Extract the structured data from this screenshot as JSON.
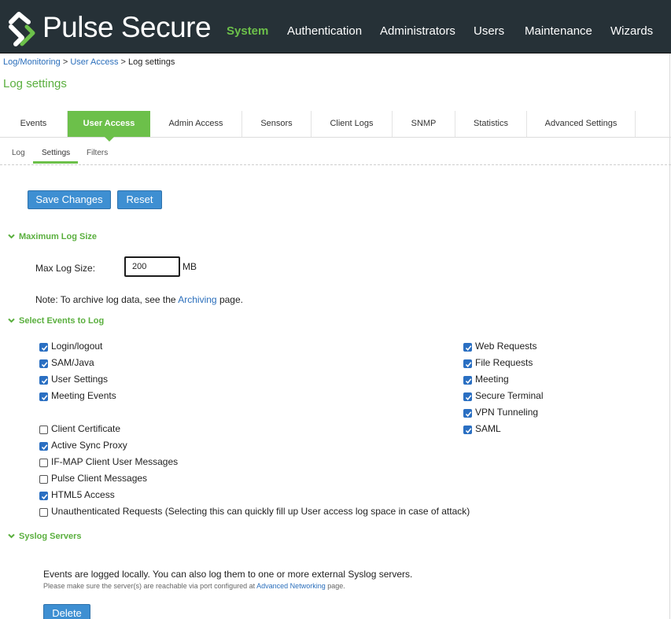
{
  "brand": {
    "name": "Pulse Secure",
    "accent": "#6cc04a",
    "link_color": "#2a6ebb",
    "header_bg": "#263137",
    "button_color": "#3e8fd2"
  },
  "nav": {
    "items": [
      {
        "label": "System",
        "active": true
      },
      {
        "label": "Authentication"
      },
      {
        "label": "Administrators"
      },
      {
        "label": "Users"
      },
      {
        "label": "Maintenance"
      },
      {
        "label": "Wizards"
      }
    ]
  },
  "breadcrumb": {
    "items": [
      "Log/Monitoring",
      "User Access"
    ],
    "current": "Log settings",
    "separator": ">"
  },
  "page_title": "Log settings",
  "tabs": [
    "Events",
    "User Access",
    "Admin Access",
    "Sensors",
    "Client Logs",
    "SNMP",
    "Statistics",
    "Advanced Settings"
  ],
  "active_tab": "User Access",
  "subtabs": [
    "Log",
    "Settings",
    "Filters"
  ],
  "active_subtab": "Settings",
  "buttons": {
    "save": "Save Changes",
    "reset": "Reset",
    "delete": "Delete"
  },
  "max_log_size": {
    "section_title": "Maximum Log Size",
    "label": "Max Log Size:",
    "value": "200",
    "unit": "MB",
    "note_prefix": "Note: To archive log data, see the",
    "note_link": "Archiving",
    "note_suffix": "page."
  },
  "select_events": {
    "section_title": "Select Events to Log",
    "left": [
      {
        "label": "Login/logout",
        "checked": true
      },
      {
        "label": "SAM/Java",
        "checked": true
      },
      {
        "label": "User Settings",
        "checked": true
      },
      {
        "label": "Meeting Events",
        "checked": true
      },
      {
        "label": "Client Certificate",
        "checked": false
      },
      {
        "label": "Active Sync Proxy",
        "checked": true
      },
      {
        "label": "IF-MAP Client User Messages",
        "checked": false
      },
      {
        "label": "Pulse Client Messages",
        "checked": false
      },
      {
        "label": "HTML5 Access",
        "checked": true
      },
      {
        "label": "Unauthenticated Requests (Selecting this can quickly fill up User access log space in case of attack)",
        "checked": false
      }
    ],
    "right": [
      {
        "label": "Web Requests",
        "checked": true
      },
      {
        "label": "File Requests",
        "checked": true
      },
      {
        "label": "Meeting",
        "checked": true
      },
      {
        "label": "Secure Terminal",
        "checked": true
      },
      {
        "label": "VPN Tunneling",
        "checked": true
      },
      {
        "label": "SAML",
        "checked": true
      }
    ]
  },
  "syslog": {
    "section_title": "Syslog Servers",
    "description": "Events are logged locally. You can also log them to one or more external Syslog servers.",
    "note_prefix": "Please make sure the server(s) are reachable via port configured at",
    "note_link": "Advanced Networking",
    "note_suffix": "page."
  }
}
